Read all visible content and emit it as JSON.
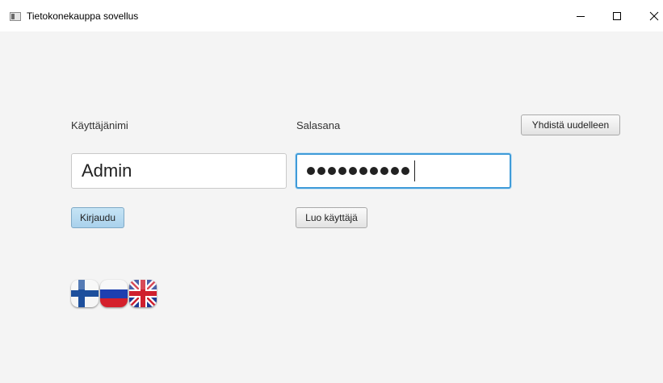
{
  "window": {
    "title": "Tietokonekauppa sovellus"
  },
  "login": {
    "username_label": "Käyttäjänimi",
    "username_value": "Admin",
    "password_label": "Salasana",
    "password_masked": "●●●●●●●●●●",
    "reconnect_button": "Yhdistä uudelleen",
    "login_button": "Kirjaudu",
    "create_user_button": "Luo käyttäjä"
  },
  "languages": [
    {
      "icon": "finnish-flag-icon"
    },
    {
      "icon": "russian-flag-icon"
    },
    {
      "icon": "british-flag-icon"
    }
  ],
  "colors": {
    "focus_border": "#3f9bd8",
    "default_button": "#a9d1ec"
  }
}
